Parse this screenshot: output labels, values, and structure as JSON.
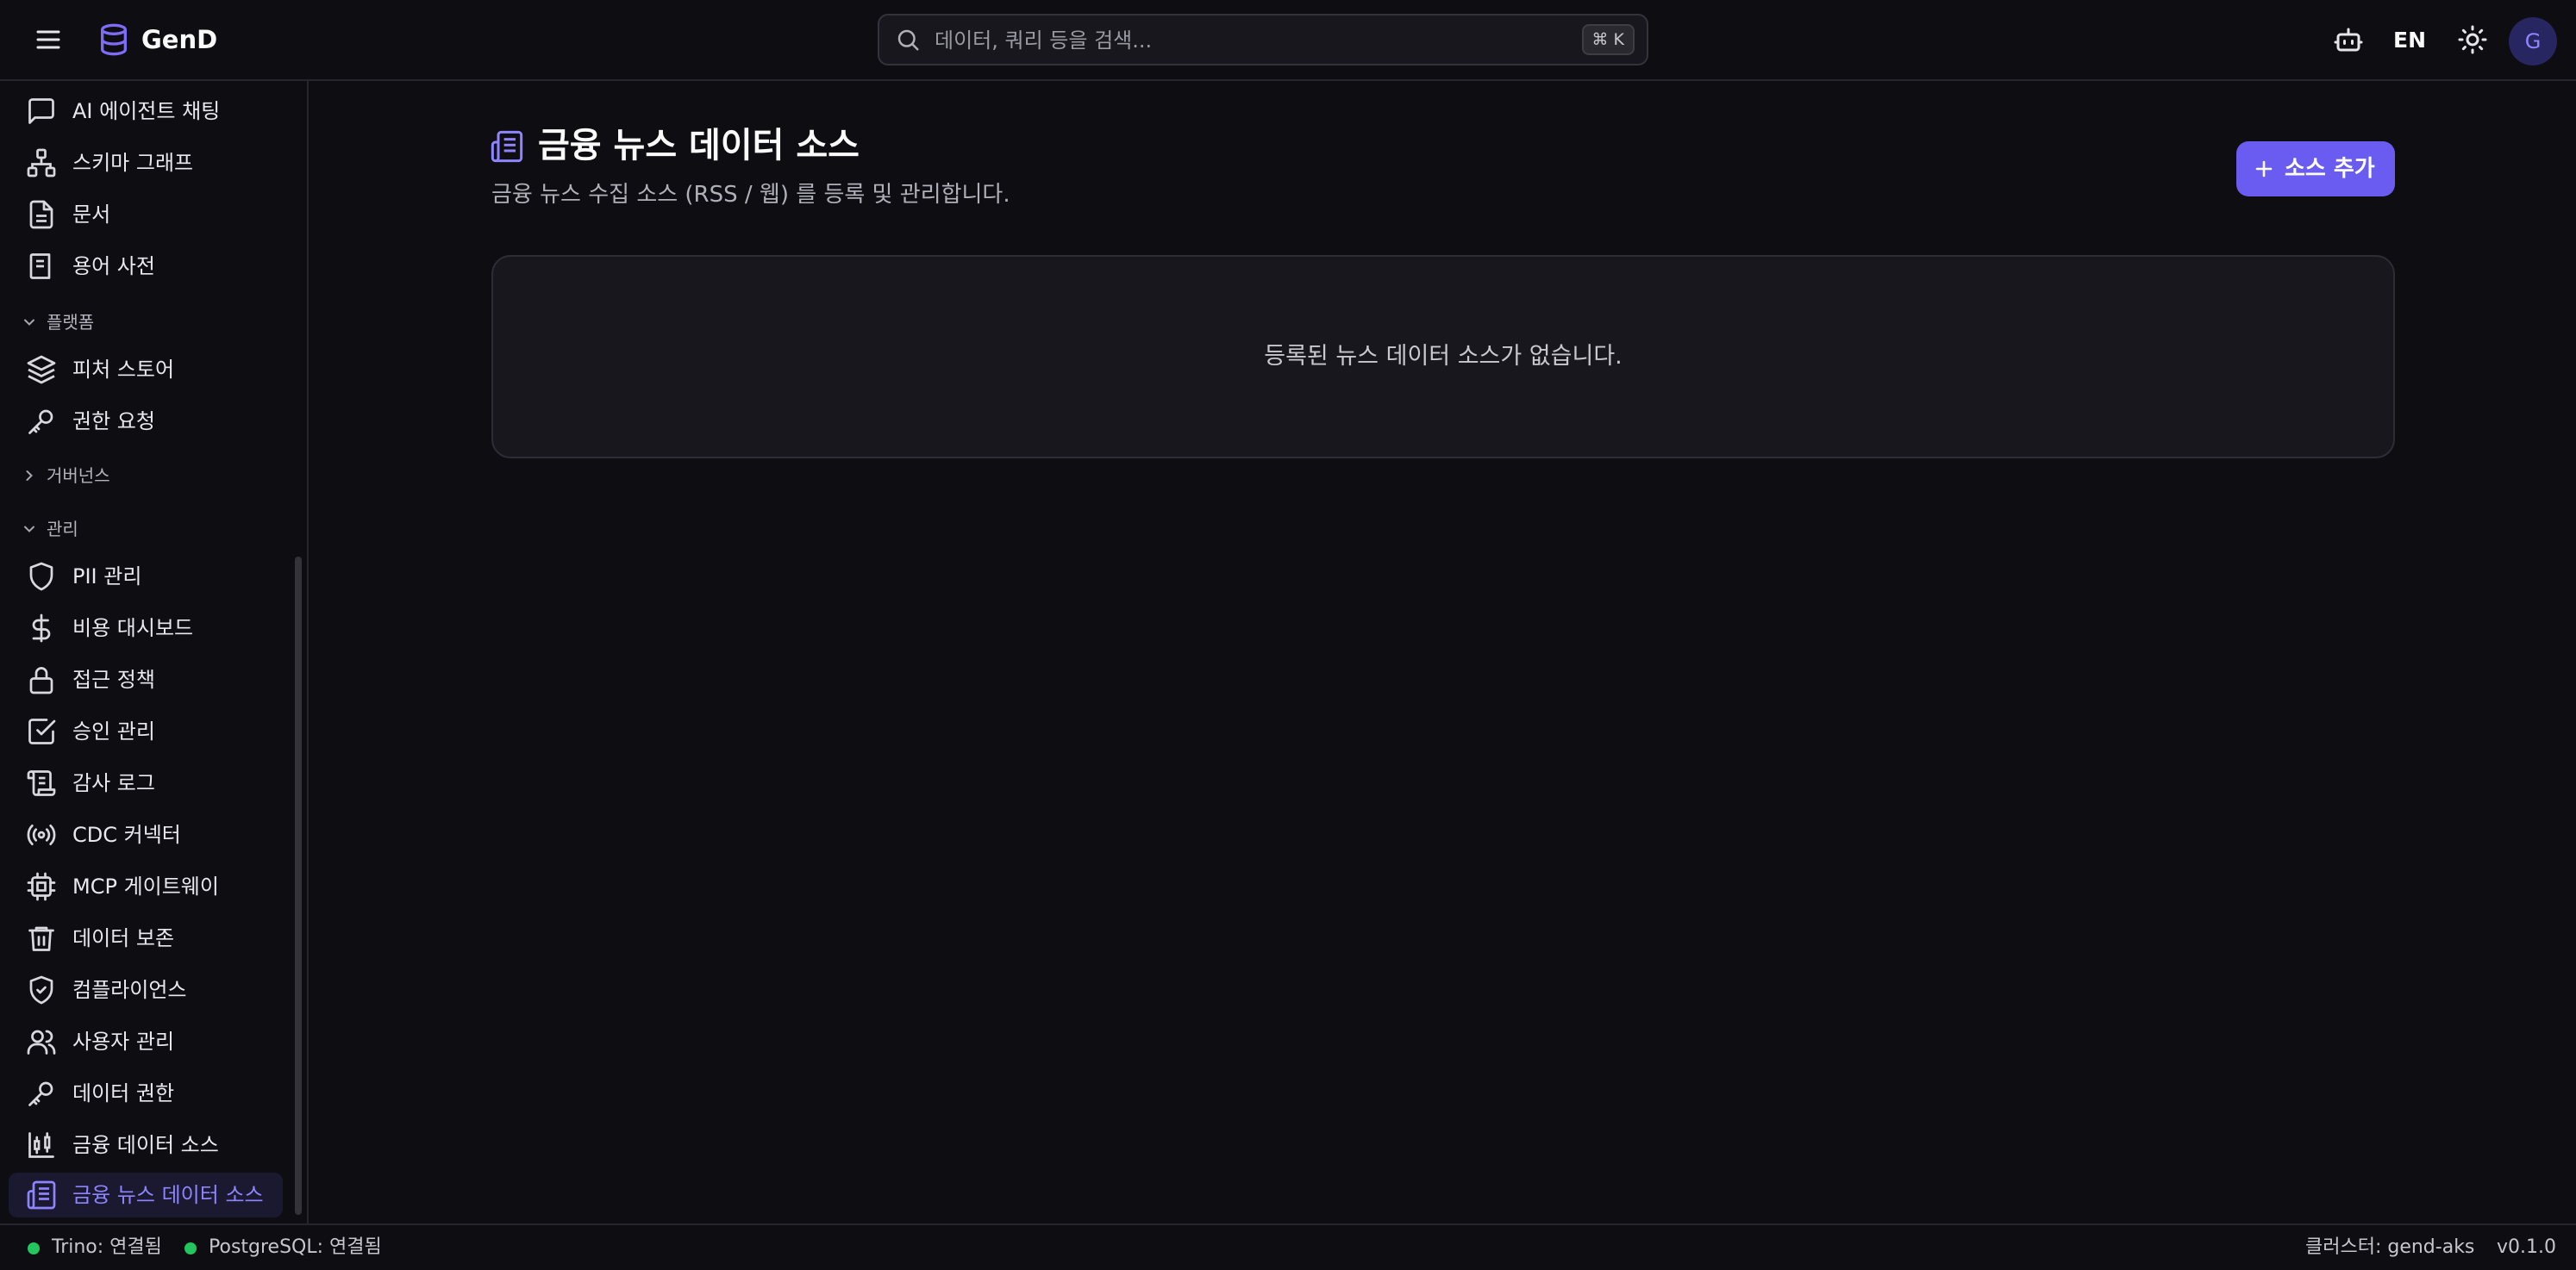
{
  "header": {
    "brand": "GenD",
    "search_placeholder": "데이터, 쿼리 등을 검색...",
    "search_shortcut": "⌘ K",
    "language": "EN",
    "avatar_initial": "G",
    "icons": [
      "menu-icon",
      "database-icon",
      "search-icon",
      "bot-icon",
      "sun-icon"
    ]
  },
  "sidebar": {
    "items_top": [
      {
        "label": "AI 에이전트 채팅",
        "icon": "message-square-icon"
      },
      {
        "label": "스키마 그래프",
        "icon": "network-icon"
      },
      {
        "label": "문서",
        "icon": "file-text-icon"
      },
      {
        "label": "용어 사전",
        "icon": "book-icon"
      }
    ],
    "section_platform": "플랫폼",
    "items_platform": [
      {
        "label": "피처 스토어",
        "icon": "layers-icon"
      },
      {
        "label": "권한 요청",
        "icon": "key-icon"
      }
    ],
    "section_governance": "거버넌스",
    "section_admin": "관리",
    "items_admin": [
      {
        "label": "PII 관리",
        "icon": "shield-icon"
      },
      {
        "label": "비용 대시보드",
        "icon": "dollar-sign-icon"
      },
      {
        "label": "접근 정책",
        "icon": "lock-icon"
      },
      {
        "label": "승인 관리",
        "icon": "check-square-icon"
      },
      {
        "label": "감사 로그",
        "icon": "scroll-icon"
      },
      {
        "label": "CDC 커넥터",
        "icon": "radio-icon"
      },
      {
        "label": "MCP 게이트웨이",
        "icon": "cpu-icon"
      },
      {
        "label": "데이터 보존",
        "icon": "trash-icon"
      },
      {
        "label": "컴플라이언스",
        "icon": "shield-check-icon"
      },
      {
        "label": "사용자 관리",
        "icon": "users-icon"
      },
      {
        "label": "데이터 권한",
        "icon": "key-icon"
      },
      {
        "label": "금융 데이터 소스",
        "icon": "candlestick-chart-icon"
      },
      {
        "label": "금융 뉴스 데이터 소스",
        "icon": "newspaper-icon",
        "active": true
      }
    ]
  },
  "main": {
    "title": "금융 뉴스 데이터 소스",
    "subtitle": "금융 뉴스 수집 소스 (RSS / 웹) 를 등록 및 관리합니다.",
    "add_button": "소스 추가",
    "empty_message": "등록된 뉴스 데이터 소스가 없습니다."
  },
  "status": {
    "trino": "Trino: 연결됨",
    "postgres": "PostgreSQL: 연결됨",
    "cluster": "클러스터: gend-aks",
    "version": "v0.1.0",
    "connected_color": "#22c55e"
  },
  "colors": {
    "accent": "#6a5cf0",
    "accent_text": "#8f84ff",
    "background": "#0e0d12"
  }
}
